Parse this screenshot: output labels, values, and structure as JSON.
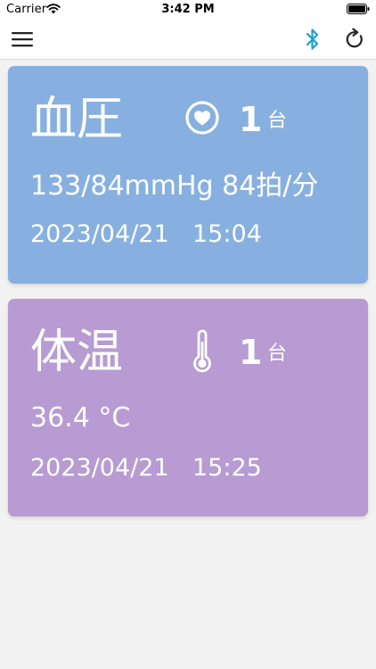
{
  "status_bar": {
    "carrier": "Carrier",
    "time": "3:42 PM"
  },
  "nav": {
    "menu_icon": "hamburger-menu-icon",
    "bluetooth_icon": "bluetooth-icon",
    "refresh_icon": "refresh-icon",
    "bluetooth_color": "#1da1c8"
  },
  "cards": {
    "blood_pressure": {
      "title": "血圧",
      "icon": "heart-icon",
      "count": "1",
      "unit": "台",
      "reading": "133/84mmHg 84拍/分",
      "date": "2023/04/21",
      "time": "15:04",
      "color": "#87b0e0"
    },
    "temperature": {
      "title": "体温",
      "icon": "thermometer-icon",
      "count": "1",
      "unit": "台",
      "reading": "36.4 °C",
      "date": "2023/04/21",
      "time": "15:25",
      "color": "#b79bd2"
    }
  }
}
